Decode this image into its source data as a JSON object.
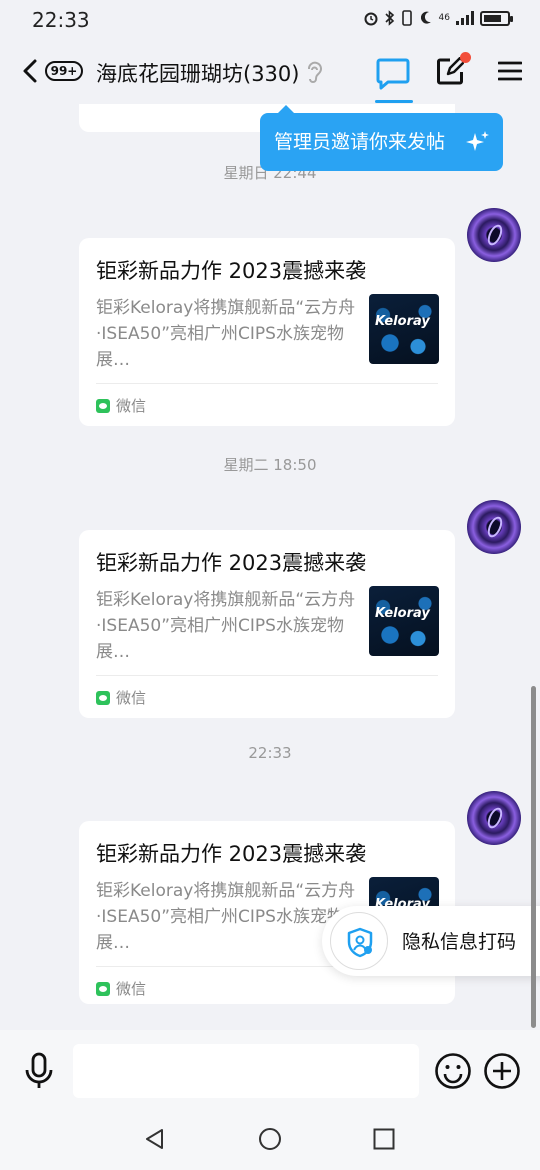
{
  "status_bar": {
    "time": "22:33",
    "network": "46",
    "battery_level": 0.75
  },
  "header": {
    "unread_badge": "99+",
    "group_name": "海底花园珊瑚坊(330)",
    "has_new_post_dot": true
  },
  "tooltip": {
    "text": "管理员邀请你来发帖"
  },
  "messages": [
    {
      "source": "微信"
    },
    {
      "time": "星期日 22:44"
    },
    {
      "title": "钜彩新品力作 2023震撼来袭",
      "desc": "钜彩Keloray将携旗舰新品“云方舟·ISEA50”亮相广州CIPS水族宠物展…",
      "thumb_text": "Keloray",
      "source": "微信"
    },
    {
      "time": "星期二 18:50"
    },
    {
      "title": "钜彩新品力作 2023震撼来袭",
      "desc": "钜彩Keloray将携旗舰新品“云方舟·ISEA50”亮相广州CIPS水族宠物展…",
      "thumb_text": "Keloray",
      "source": "微信"
    },
    {
      "time": "22:33"
    },
    {
      "title": "钜彩新品力作 2023震撼来袭",
      "desc": "钜彩Keloray将携旗舰新品“云方舟·ISEA50”亮相广州CIPS水族宠物展…",
      "thumb_text": "Keloray",
      "source": "微信"
    }
  ],
  "privacy": {
    "label": "隐私信息打码"
  },
  "input": {
    "placeholder": ""
  },
  "colors": {
    "accent": "#2aa3f3",
    "badge_red": "#f24e3a",
    "wechat_green": "#2ec25b"
  }
}
